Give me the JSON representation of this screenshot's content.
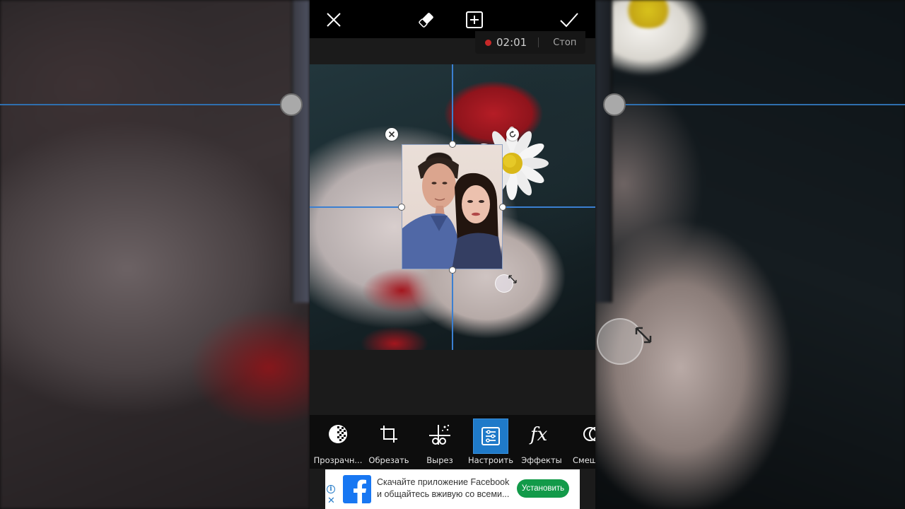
{
  "topbar": {
    "close_icon": "close-icon",
    "eraser_icon": "eraser-icon",
    "add_icon": "add-layer-icon",
    "apply_icon": "checkmark-icon"
  },
  "recording": {
    "time": "02:01",
    "stop_label": "Стоп",
    "indicator_color": "#c62828"
  },
  "canvas": {
    "guide_color": "#3b7fd1",
    "delete_icon": "close-circle-icon",
    "rotate_icon": "rotate-icon",
    "resize_icon": "resize-diagonal-icon"
  },
  "toolbar": {
    "items": [
      {
        "label": "Прозрачн...",
        "icon": "opacity-icon"
      },
      {
        "label": "Обрезать",
        "icon": "crop-icon"
      },
      {
        "label": "Вырез",
        "icon": "cutout-icon"
      },
      {
        "label": "Настроить",
        "icon": "adjust-icon",
        "active": true
      },
      {
        "label": "Эффекты",
        "icon": "fx-icon"
      },
      {
        "label": "Смеш",
        "icon": "blend-icon"
      }
    ],
    "active_color": "#1f7ac9"
  },
  "ad": {
    "line1": "Скачайте приложение Facebook",
    "line2": "и общайтесь вживую со всеми...",
    "install_label": "Установить",
    "info_glyph": "i",
    "close_glyph": "✕",
    "logo_icon": "facebook-logo-icon",
    "button_color": "#129a49"
  }
}
